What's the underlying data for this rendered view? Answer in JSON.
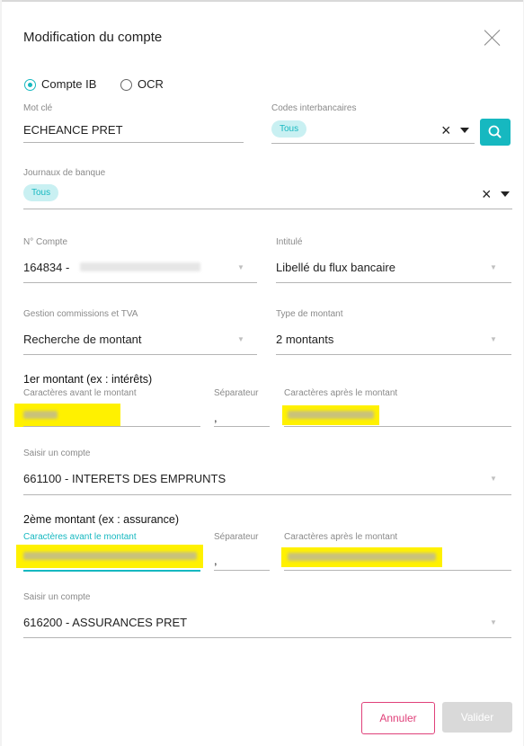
{
  "dialog": {
    "title": "Modification du compte"
  },
  "mode": {
    "option1": "Compte IB",
    "option2": "OCR",
    "selected": "Compte IB"
  },
  "mot_cle": {
    "label": "Mot clé",
    "value": "ECHEANCE PRET"
  },
  "codes_interbancaires": {
    "label": "Codes interbancaires",
    "chip": "Tous"
  },
  "journaux": {
    "label": "Journaux de banque",
    "chip": "Tous"
  },
  "compte": {
    "label": "N° Compte",
    "value_prefix": "164834 -"
  },
  "intitule": {
    "label": "Intitulé",
    "value": "Libellé du flux bancaire"
  },
  "gestion": {
    "label": "Gestion commissions et TVA",
    "value": "Recherche de montant"
  },
  "type_montant": {
    "label": "Type de montant",
    "value": "2 montants"
  },
  "montant1": {
    "title": "1er montant (ex : intérêts)",
    "before_label": "Caractères avant le montant",
    "separator_label": "Séparateur",
    "separator_value": ",",
    "after_label": "Caractères après le montant"
  },
  "compte1": {
    "label": "Saisir un compte",
    "value": "661100 - INTERETS DES EMPRUNTS"
  },
  "montant2": {
    "title": "2ème montant (ex : assurance)",
    "before_label": "Caractères avant le montant",
    "separator_label": "Séparateur",
    "separator_value": ",",
    "after_label": "Caractères après le montant"
  },
  "compte2": {
    "label": "Saisir un compte",
    "value": "616200 - ASSURANCES PRET"
  },
  "buttons": {
    "cancel": "Annuler",
    "validate": "Valider"
  },
  "colors": {
    "accent": "#16b8c0",
    "cancel": "#e0417a",
    "highlight": "#fff100"
  }
}
